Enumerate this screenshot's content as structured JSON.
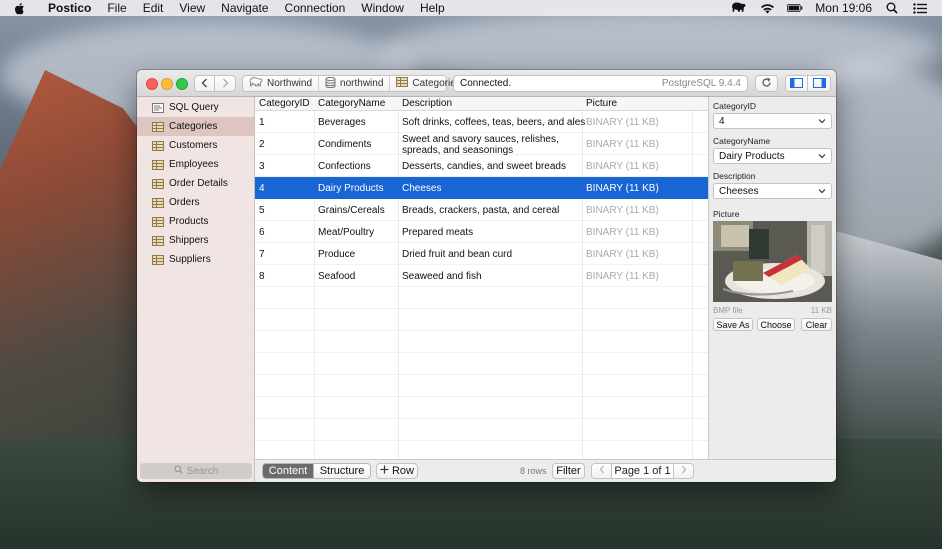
{
  "menubar": {
    "app_name": "Postico",
    "items": [
      "File",
      "Edit",
      "View",
      "Navigate",
      "Connection",
      "Window",
      "Help"
    ],
    "clock": "Mon 19:06"
  },
  "titlebar": {
    "breadcrumbs": [
      "Northwind",
      "northwind",
      "Categories"
    ],
    "status": "Connected.",
    "server_version": "PostgreSQL 9.4.4"
  },
  "sidebar": {
    "items": [
      {
        "label": "SQL Query",
        "icon": "sql-query-icon",
        "selected": false
      },
      {
        "label": "Categories",
        "icon": "table-icon",
        "selected": true
      },
      {
        "label": "Customers",
        "icon": "table-icon",
        "selected": false
      },
      {
        "label": "Employees",
        "icon": "table-icon",
        "selected": false
      },
      {
        "label": "Order Details",
        "icon": "table-icon",
        "selected": false
      },
      {
        "label": "Orders",
        "icon": "table-icon",
        "selected": false
      },
      {
        "label": "Products",
        "icon": "table-icon",
        "selected": false
      },
      {
        "label": "Shippers",
        "icon": "table-icon",
        "selected": false
      },
      {
        "label": "Suppliers",
        "icon": "table-icon",
        "selected": false
      }
    ],
    "search_placeholder": "Search"
  },
  "table": {
    "columns": [
      "CategoryID",
      "CategoryName",
      "Description",
      "Picture"
    ],
    "rows": [
      {
        "id": "1",
        "name": "Beverages",
        "description": "Soft drinks, coffees, teas, beers, and ales",
        "picture": "BINARY (11 KB)",
        "selected": false
      },
      {
        "id": "2",
        "name": "Condiments",
        "description": "Sweet and savory sauces, relishes, spreads, and seasonings",
        "picture": "BINARY (11 KB)",
        "selected": false
      },
      {
        "id": "3",
        "name": "Confections",
        "description": "Desserts, candies, and sweet breads",
        "picture": "BINARY (11 KB)",
        "selected": false
      },
      {
        "id": "4",
        "name": "Dairy Products",
        "description": "Cheeses",
        "picture": "BINARY (11 KB)",
        "selected": true
      },
      {
        "id": "5",
        "name": "Grains/Cereals",
        "description": "Breads, crackers, pasta, and cereal",
        "picture": "BINARY (11 KB)",
        "selected": false
      },
      {
        "id": "6",
        "name": "Meat/Poultry",
        "description": "Prepared meats",
        "picture": "BINARY (11 KB)",
        "selected": false
      },
      {
        "id": "7",
        "name": "Produce",
        "description": "Dried fruit and bean curd",
        "picture": "BINARY (11 KB)",
        "selected": false
      },
      {
        "id": "8",
        "name": "Seafood",
        "description": "Seaweed and fish",
        "picture": "BINARY (11 KB)",
        "selected": false
      }
    ]
  },
  "bottombar": {
    "tab_content": "Content",
    "tab_structure": "Structure",
    "add_row": "Row",
    "row_count": "8 rows",
    "filter": "Filter",
    "page": "Page 1 of 1"
  },
  "inspector": {
    "fields": [
      {
        "label": "CategoryID",
        "value": "4"
      },
      {
        "label": "CategoryName",
        "value": "Dairy Products"
      },
      {
        "label": "Description",
        "value": "Cheeses"
      }
    ],
    "picture_label": "Picture",
    "file_type": "BMP file",
    "file_size": "11 KB",
    "buttons": {
      "save_as": "Save As",
      "choose": "Choose",
      "clear": "Clear"
    }
  },
  "colors": {
    "selection_blue": "#1865d4",
    "sidebar_selected": "#dfc5c1",
    "close": "#fc605c",
    "minimize": "#fdbc40",
    "maximize": "#34c84a"
  }
}
